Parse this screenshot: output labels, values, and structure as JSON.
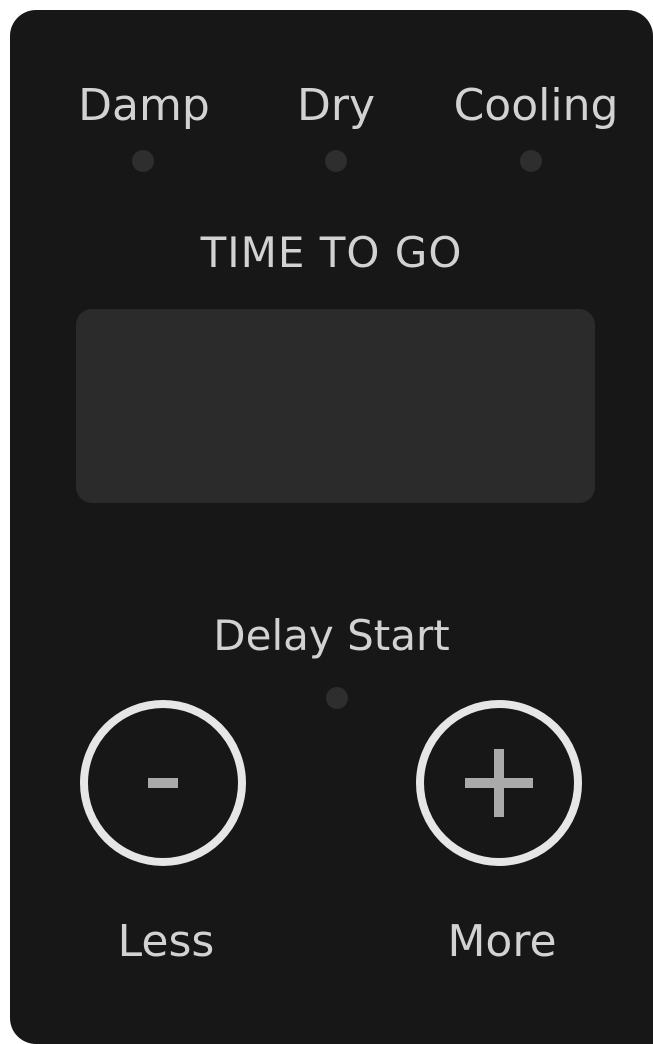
{
  "status": {
    "damp_label": "Damp",
    "dry_label": "Dry",
    "cooling_label": "Cooling"
  },
  "timer": {
    "title": "TIME TO GO",
    "value": ""
  },
  "delay": {
    "label": "Delay Start"
  },
  "controls": {
    "less_label": "Less",
    "more_label": "More"
  },
  "colors": {
    "panel": "#171717",
    "text": "#d2d2d2",
    "button_ring": "#e6e6e6",
    "indicator_off": "#2e2e2e"
  }
}
